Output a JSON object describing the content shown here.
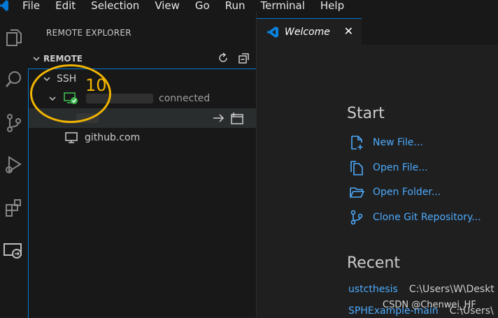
{
  "menu": [
    "File",
    "Edit",
    "Selection",
    "View",
    "Go",
    "Run",
    "Terminal",
    "Help"
  ],
  "sidebar": {
    "title": "REMOTE EXPLORER",
    "section": "REMOTE",
    "tree": {
      "ssh_label": "SSH",
      "host_status": "connected",
      "github": "github.com"
    }
  },
  "annotation": {
    "number": "10"
  },
  "tabs": [
    {
      "label": "Welcome",
      "close": "✕"
    }
  ],
  "welcome": {
    "start_heading": "Start",
    "start_links": [
      "New File...",
      "Open File...",
      "Open Folder...",
      "Clone Git Repository..."
    ],
    "recent_heading": "Recent",
    "recent": [
      {
        "name": "ustcthesis",
        "path": "C:\\Users\\W\\Deskt"
      },
      {
        "name": "SPHExample-main",
        "path": "C:\\Users\\"
      }
    ]
  },
  "watermark": "CSDN @Chenwei_HF",
  "colors": {
    "accent": "#0078d4",
    "link": "#4daafc",
    "annotation": "#f0b400",
    "connected": "#3fb950"
  }
}
